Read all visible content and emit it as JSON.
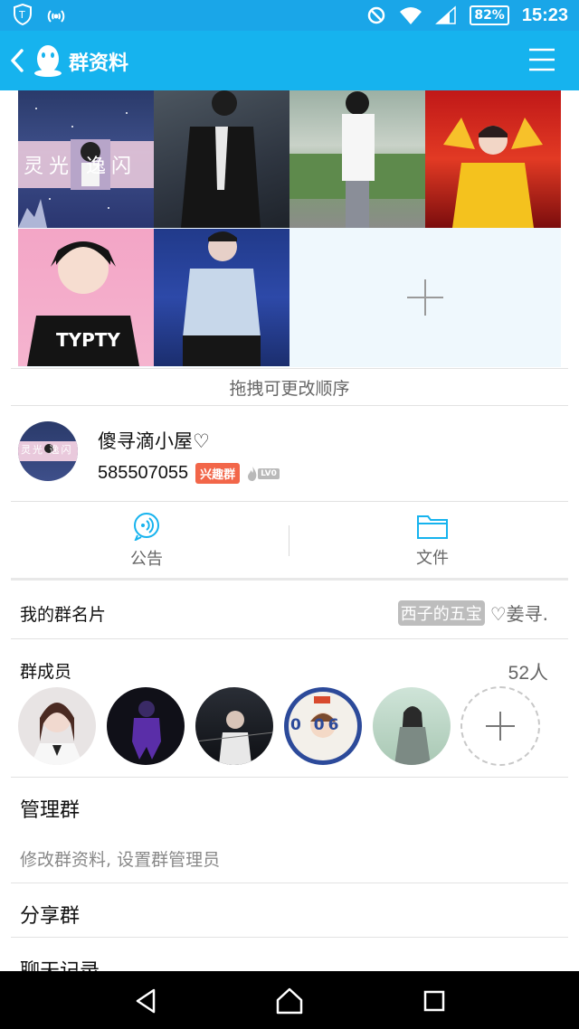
{
  "status_bar": {
    "battery": "82%",
    "time": "15:23"
  },
  "title_bar": {
    "title": "群资料"
  },
  "photo_grid": {
    "first_photo_banner": "灵光 逸闪",
    "hint": "拖拽可更改顺序"
  },
  "group": {
    "name": "傻寻滴小屋♡",
    "id": "585507055",
    "tag": "兴趣群",
    "level": "LV0",
    "avatar_text": "灵光 逸闪"
  },
  "actions": {
    "notice": "公告",
    "files": "文件"
  },
  "card": {
    "label": "我的群名片",
    "chip": "西子的五宝",
    "suffix": "♡姜寻."
  },
  "members": {
    "label": "群成员",
    "count": "52人",
    "avatar_text": "0 06"
  },
  "manage": {
    "title": "管理群",
    "desc": "修改群资料, 设置群管理员"
  },
  "share": {
    "title": "分享群"
  },
  "history": {
    "title": "聊天记录"
  },
  "colors": {
    "accent": "#16b3ee",
    "status_bar": "#1aa6e8",
    "tag": "#f26649"
  }
}
